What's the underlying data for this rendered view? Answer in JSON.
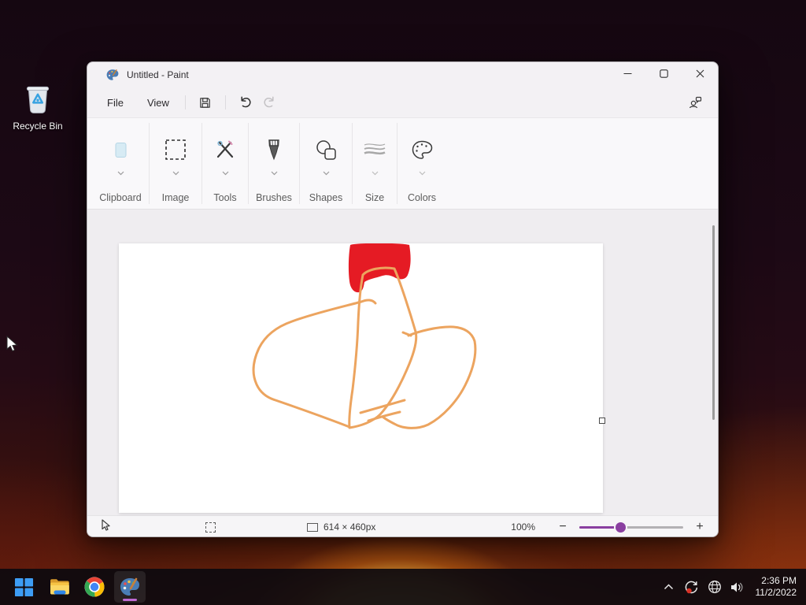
{
  "desktop": {
    "recycle_bin_label": "Recycle Bin"
  },
  "window": {
    "title": "Untitled - Paint",
    "menu": {
      "file": "File",
      "view": "View"
    },
    "ribbon": {
      "groups": [
        {
          "label": "Clipboard",
          "icon": "clipboard-icon"
        },
        {
          "label": "Image",
          "icon": "selection-icon"
        },
        {
          "label": "Tools",
          "icon": "tools-icon"
        },
        {
          "label": "Brushes",
          "icon": "brush-icon"
        },
        {
          "label": "Shapes",
          "icon": "shapes-icon"
        },
        {
          "label": "Size",
          "icon": "stroke-size-icon"
        },
        {
          "label": "Colors",
          "icon": "palette-icon"
        }
      ]
    },
    "statusbar": {
      "canvas_size": "614 × 460px",
      "zoom_level": "100%",
      "zoom_out": "−",
      "zoom_in": "+"
    }
  },
  "taskbar": {
    "clock": {
      "time": "2:36 PM",
      "date": "11/2/2022"
    }
  },
  "drawing": {
    "red": "#e51b24",
    "orange": "#eca45f"
  },
  "colors": {
    "accent_purple": "#8a3fa0",
    "taskbar_indicator": "#c06bd4",
    "window_bg": "#f3f1f4",
    "ribbon_bg": "#f9f8fa",
    "canvas_area_bg": "#efedf0"
  },
  "icons": {
    "tray": [
      "chevron-up-icon",
      "sync-update-icon",
      "network-globe-icon",
      "speaker-icon"
    ],
    "taskbar": [
      "start-icon",
      "file-explorer-icon",
      "chrome-icon",
      "paint-icon"
    ],
    "titlebar": [
      "paint-app-icon",
      "minimize-icon",
      "maximize-icon",
      "close-icon"
    ],
    "menubar": [
      "save-icon",
      "undo-icon",
      "redo-icon",
      "feedback-icon"
    ]
  }
}
